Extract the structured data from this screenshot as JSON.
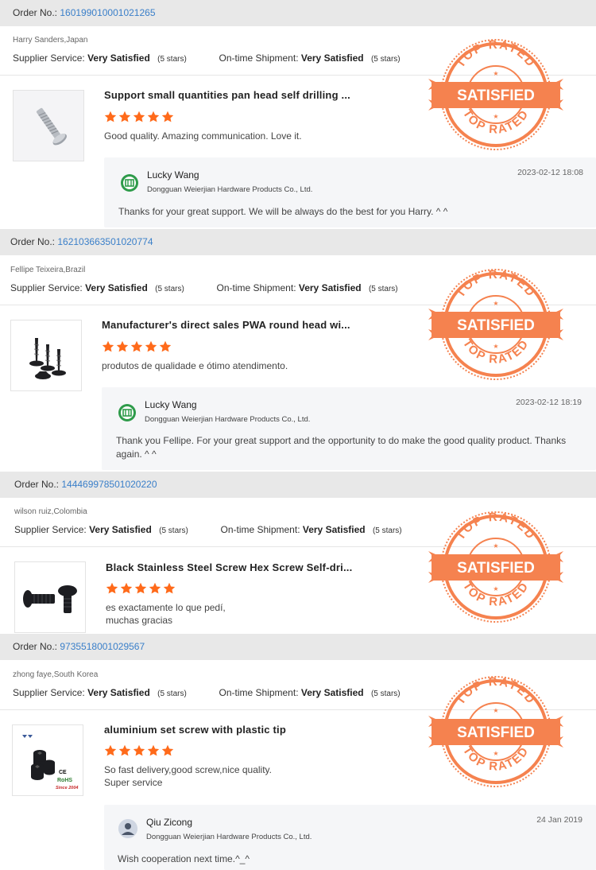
{
  "labels": {
    "order_no": "Order No.:",
    "supplier_service": "Supplier Service:",
    "ontime_shipment": "On-time Shipment:",
    "stamp_top": "TOP RATED",
    "stamp_mid": "SATISFIED",
    "stamp_bottom": "TOP RATED"
  },
  "colors": {
    "accent_link": "#3a7fc9",
    "star": "#ff6a1a",
    "stamp": "#f5824f",
    "order_bar": "#e8e8e8",
    "reply_bg": "#f5f6f8"
  },
  "orders": [
    {
      "order_number": "160199010001021265",
      "buyer": "Harry Sanders,Japan",
      "supplier_service_value": "Very Satisfied",
      "supplier_service_stars": "(5 stars)",
      "shipment_value": "Very Satisfied",
      "shipment_stars": "(5 stars)",
      "product_title": "Support small quantities pan head self drilling ...",
      "rating": 5,
      "review": "Good quality. Amazing communication. Love it.",
      "product_image": "silver-pan-head-screw",
      "reply": {
        "name": "Lucky Wang",
        "company": "Dongguan Weierjian Hardware Products Co., Ltd.",
        "date": "2023-02-12 18:08",
        "text": "Thanks for your great support. We will be always do the best for you Harry.  ^  ^",
        "avatar": "company-logo-icon"
      }
    },
    {
      "order_number": "162103663501020774",
      "buyer": "Fellipe Teixeira,Brazil",
      "supplier_service_value": "Very Satisfied",
      "supplier_service_stars": "(5 stars)",
      "shipment_value": "Very Satisfied",
      "shipment_stars": "(5 stars)",
      "product_title": "Manufacturer's direct sales PWA round head wi...",
      "rating": 5,
      "review": "produtos de qualidade e ótimo atendimento.",
      "product_image": "black-self-tapping-screws",
      "reply": {
        "name": "Lucky Wang",
        "company": "Dongguan Weierjian Hardware Products Co., Ltd.",
        "date": "2023-02-12 18:19",
        "text": "Thank you Fellipe. For your great support and the opportunity to do make the good quality product. Thanks again. ^ ^",
        "avatar": "company-logo-icon"
      }
    },
    {
      "order_number": "144469978501020220",
      "buyer": "wilson ruiz,Colombia",
      "supplier_service_value": "Very Satisfied",
      "supplier_service_stars": "(5 stars)",
      "shipment_value": "Very Satisfied",
      "shipment_stars": "(5 stars)",
      "product_title": "Black Stainless Steel Screw Hex Screw Self-dri...",
      "rating": 5,
      "review": "es exactamente lo que pedí, muchas gracias",
      "product_image": "black-hex-screw"
    },
    {
      "order_number": "9735518001029567",
      "buyer": "zhong faye,South Korea",
      "supplier_service_value": "Very Satisfied",
      "supplier_service_stars": "(5 stars)",
      "shipment_value": "Very Satisfied",
      "shipment_stars": "(5 stars)",
      "product_title": "aluminium set screw with plastic tip",
      "rating": 5,
      "review": "So fast delivery,good screw,nice quality. Super service",
      "product_image": "black-set-screws",
      "product_image_text": [
        "CE",
        "RoHS",
        "Since 2004"
      ],
      "reply": {
        "name": "Qiu Zicong",
        "company": "Dongguan Weierjian Hardware Products Co., Ltd.",
        "date": "24 Jan 2019",
        "text": "Wish cooperation next time.^_^",
        "avatar": "user-avatar-icon"
      }
    }
  ]
}
